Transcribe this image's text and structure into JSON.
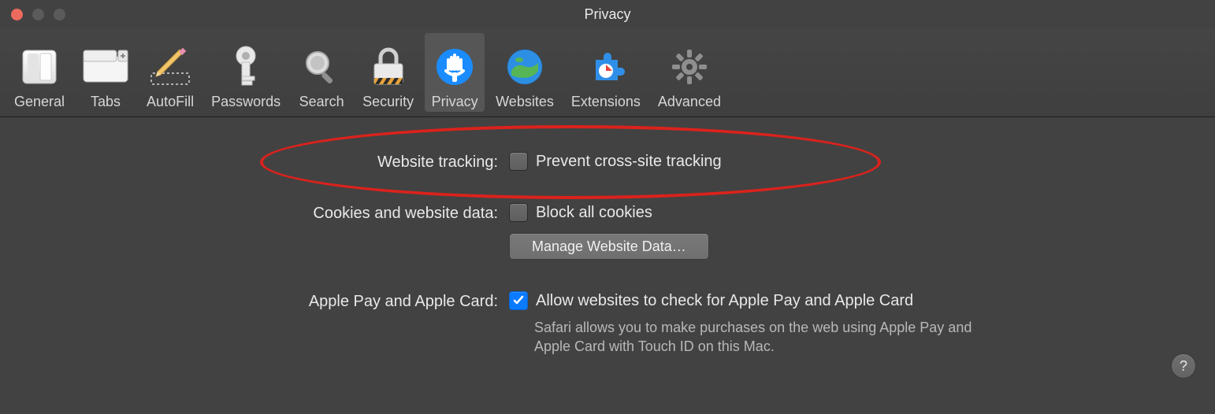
{
  "window": {
    "title": "Privacy"
  },
  "toolbar": {
    "items": [
      {
        "id": "general",
        "label": "General"
      },
      {
        "id": "tabs",
        "label": "Tabs"
      },
      {
        "id": "autofill",
        "label": "AutoFill"
      },
      {
        "id": "passwords",
        "label": "Passwords"
      },
      {
        "id": "search",
        "label": "Search"
      },
      {
        "id": "security",
        "label": "Security"
      },
      {
        "id": "privacy",
        "label": "Privacy",
        "selected": true
      },
      {
        "id": "websites",
        "label": "Websites"
      },
      {
        "id": "extensions",
        "label": "Extensions"
      },
      {
        "id": "advanced",
        "label": "Advanced"
      }
    ]
  },
  "form": {
    "website_tracking": {
      "label": "Website tracking:",
      "checkbox_label": "Prevent cross-site tracking",
      "checked": false
    },
    "cookies": {
      "label": "Cookies and website data:",
      "checkbox_label": "Block all cookies",
      "checked": false,
      "button_label": "Manage Website Data…"
    },
    "apple_pay": {
      "label": "Apple Pay and Apple Card:",
      "checkbox_label": "Allow websites to check for Apple Pay and Apple Card",
      "checked": true,
      "hint": "Safari allows you to make purchases on the web using Apple Pay and Apple Card with Touch ID on this Mac."
    }
  },
  "help_button": "?",
  "annotation": {
    "highlight": "website_tracking_row"
  }
}
